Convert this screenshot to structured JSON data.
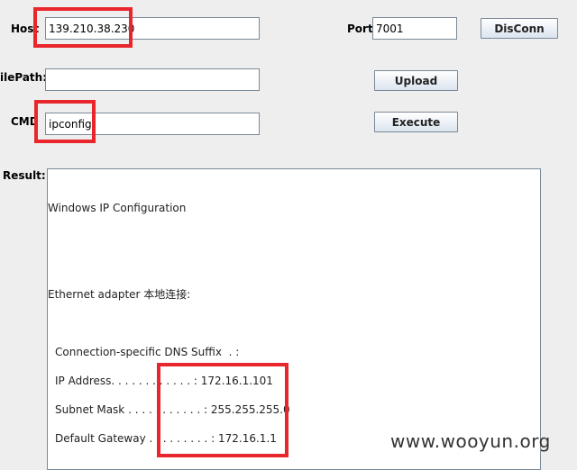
{
  "form": {
    "host_label": "Host",
    "host_value": "139.210.38.230",
    "port_label": "Port:",
    "port_value": "7001",
    "disconn_label": "DisConn",
    "filepath_label": "ilePath:",
    "filepath_value": "",
    "upload_label": "Upload",
    "cmd_label": "CMD",
    "cmd_value": "ipconfig",
    "execute_label": "Execute",
    "result_label": "Result:"
  },
  "result": {
    "lines": [
      "Windows IP Configuration",
      "Ethernet adapter 本地连接:",
      "Connection-specific DNS Suffix  . :",
      "IP Address. . . . . . . . . . . . : 172.16.1.101",
      "Subnet Mask . . . . . . . . . . . : 255.255.255.0",
      "Default Gateway . . . . . . . . . : 172.16.1.1"
    ]
  },
  "watermark": "www.wooyun.org",
  "colors": {
    "highlight": "#e8262c",
    "background": "#eeeeee"
  }
}
